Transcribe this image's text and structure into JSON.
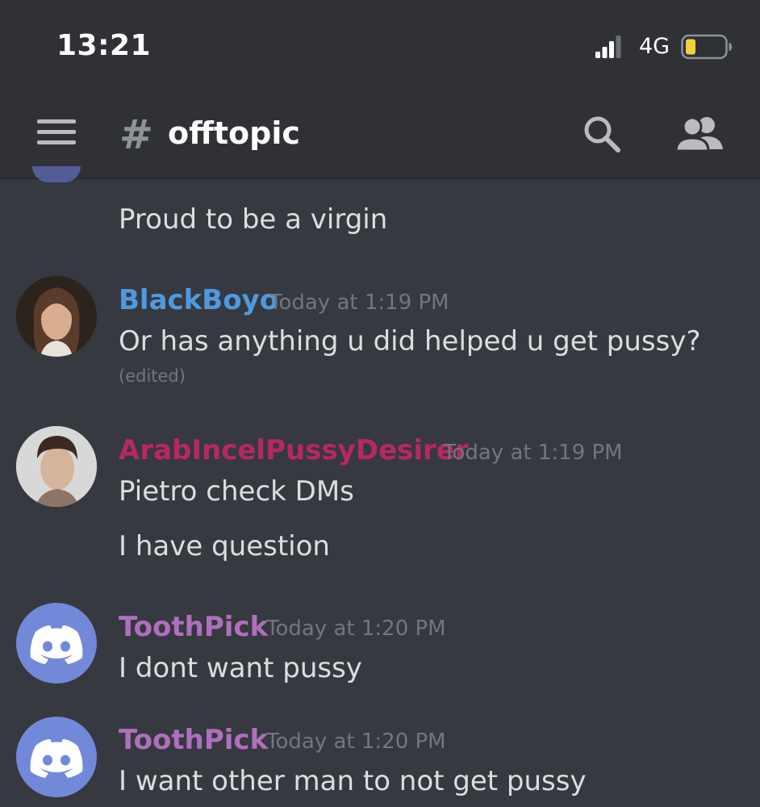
{
  "status_bar": {
    "time": "13:21",
    "network": "4G"
  },
  "header": {
    "hash": "#",
    "channel_name": "offtopic"
  },
  "colors": {
    "blackboyo": "#4e9ae0",
    "arabincel": "#b7285f",
    "toothpick": "#b06fbe",
    "discord_blurple": "#7289da",
    "battery_low": "#f0d23a"
  },
  "messages": [
    {
      "text": "Proud to be a virgin"
    },
    {
      "username": "BlackBoyo",
      "timestamp": "Today at 1:19 PM",
      "text": "Or has anything u did helped u get pussy?",
      "edited": "(edited)"
    },
    {
      "username": "ArabIncelPussyDesirer",
      "timestamp": "Today at 1:19 PM",
      "text": "Pietro check DMs",
      "text2": "I have question"
    },
    {
      "username": "ToothPick",
      "timestamp": "Today at 1:20 PM",
      "text": "I dont want pussy"
    },
    {
      "username": "ToothPick",
      "timestamp": "Today at 1:20 PM",
      "text": "I want other man to not get pussy"
    }
  ]
}
